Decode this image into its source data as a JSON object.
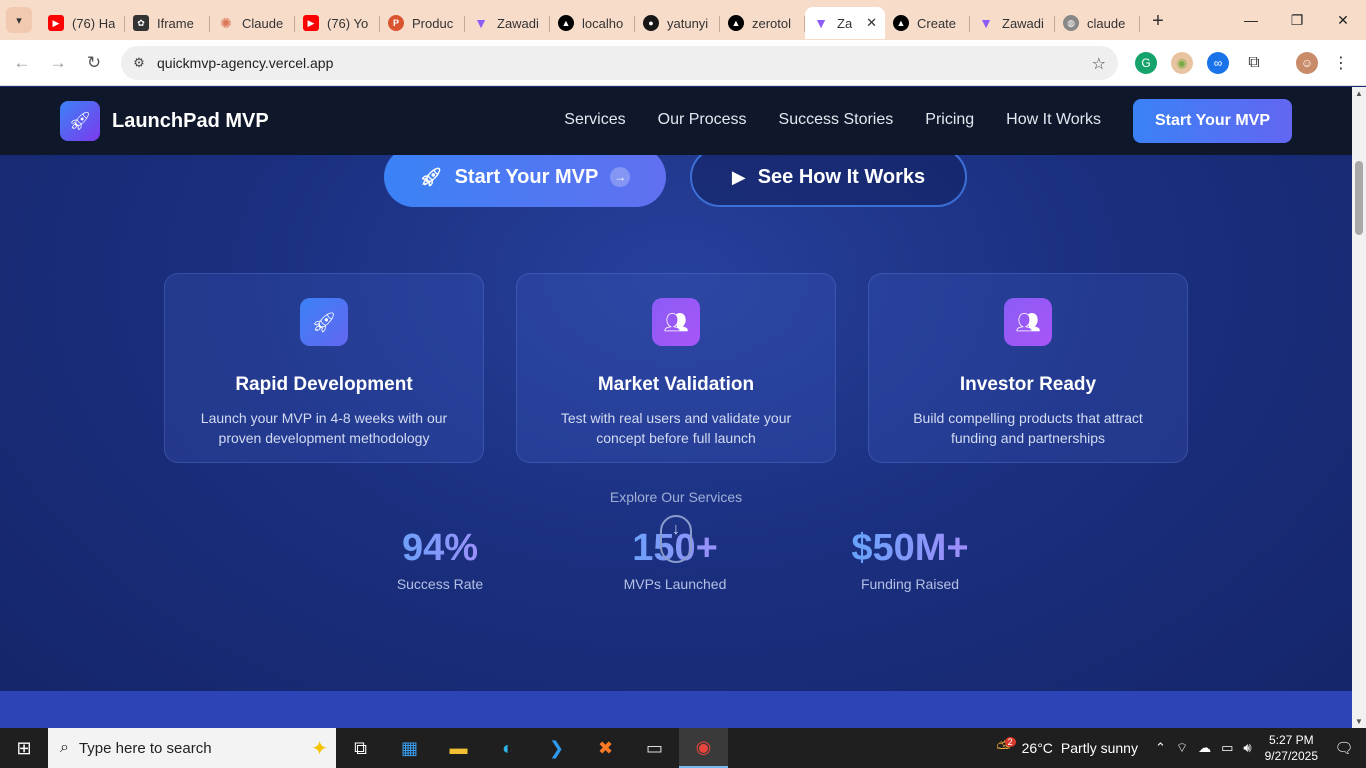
{
  "browser": {
    "tabs": [
      {
        "label": "(76) Ha",
        "icon": "youtube-icon",
        "color": "#ff0000"
      },
      {
        "label": "Iframe",
        "icon": "openai-icon",
        "color": "#333333"
      },
      {
        "label": "Claude",
        "icon": "claude-icon",
        "color": "#d97757"
      },
      {
        "label": "(76) Yo",
        "icon": "youtube-icon",
        "color": "#ff0000"
      },
      {
        "label": "Produc",
        "icon": "producthunt-icon",
        "color": "#da552f"
      },
      {
        "label": "Zawadi",
        "icon": "vite-icon",
        "color": "#8b5cf6"
      },
      {
        "label": "localho",
        "icon": "vercel-icon",
        "color": "#000000"
      },
      {
        "label": "yatunyi",
        "icon": "github-icon",
        "color": "#181717"
      },
      {
        "label": "zerotol",
        "icon": "vercel-icon",
        "color": "#000000"
      },
      {
        "label": "Za",
        "icon": "vite-icon",
        "color": "#8b5cf6",
        "active": true
      },
      {
        "label": "Create",
        "icon": "vercel-icon",
        "color": "#000000"
      },
      {
        "label": "Zawadi",
        "icon": "vite-icon",
        "color": "#8b5cf6"
      },
      {
        "label": "claude",
        "icon": "globe-icon",
        "color": "#777777"
      }
    ],
    "url": "quickmvp-agency.vercel.app"
  },
  "site": {
    "brand": "LaunchPad MVP",
    "nav": [
      "Services",
      "Our Process",
      "Success Stories",
      "Pricing",
      "How It Works"
    ],
    "nav_cta": "Start Your MVP",
    "hero_primary": "Start Your MVP",
    "hero_secondary": "See How It Works",
    "cards": [
      {
        "title": "Rapid Development",
        "desc": "Launch your MVP in 4-8 weeks with our proven development methodology",
        "icon": "rocket-icon"
      },
      {
        "title": "Market Validation",
        "desc": "Test with real users and validate your concept before full launch",
        "icon": "users-icon"
      },
      {
        "title": "Investor Ready",
        "desc": "Build compelling products that attract funding and partnerships",
        "icon": "users-icon"
      }
    ],
    "explore": "Explore Our Services",
    "stats": [
      {
        "value": "94%",
        "label": "Success Rate"
      },
      {
        "value": "150+",
        "label": "MVPs Launched"
      },
      {
        "value": "$50M+",
        "label": "Funding Raised"
      }
    ]
  },
  "taskbar": {
    "search_placeholder": "Type here to search",
    "weather_temp": "26°C",
    "weather_text": "Partly sunny",
    "weather_badge": "2",
    "time": "5:27 PM",
    "date": "9/27/2025"
  },
  "colors": {
    "accent_blue": "#3b82f6",
    "accent_purple": "#8b5cf6",
    "nav_bg": "#0f172a",
    "hero_bg": "#1a2f7f"
  }
}
